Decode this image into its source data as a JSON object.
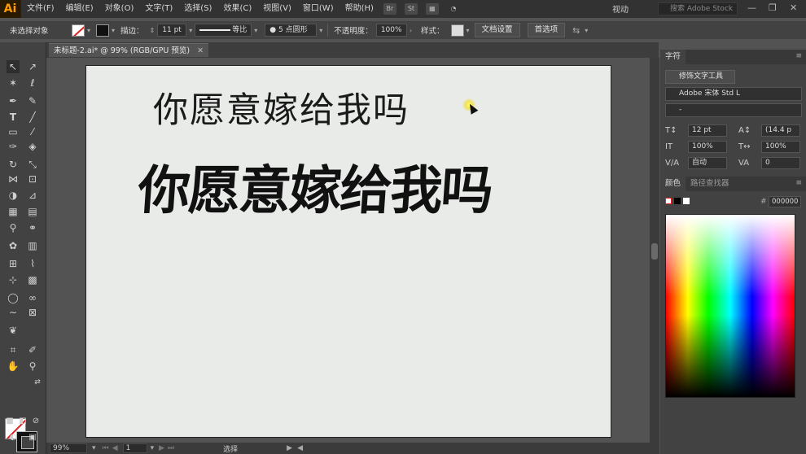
{
  "app": {
    "logo": "Ai"
  },
  "menu": {
    "items": [
      "文件(F)",
      "编辑(E)",
      "对象(O)",
      "文字(T)",
      "选择(S)",
      "效果(C)",
      "视图(V)",
      "窗口(W)",
      "帮助(H)"
    ],
    "bridge_label": "Br",
    "stock_label": "St",
    "workspace": "视动",
    "search_placeholder": "搜索 Adobe Stock"
  },
  "control_bar": {
    "selection_status": "未选择对象",
    "stroke_label": "描边：",
    "stroke_value": "11 pt",
    "stroke_profile": "等比",
    "brush_value": "5 点圆形",
    "opacity_label": "不透明度：",
    "opacity_value": "100%",
    "style_label": "样式：",
    "doc_setup_label": "文档设置",
    "preferences_label": "首选项"
  },
  "document": {
    "tab_title": "未标题-2.ai* @ 99% (RGB/GPU 预览)",
    "line1": "你愿意嫁给我吗",
    "line2": "你愿意嫁给我吗"
  },
  "status_bar": {
    "zoom": "99%",
    "page": "1",
    "tool": "选择"
  },
  "character_panel": {
    "tab": "字符",
    "touch_type_label": "修饰文字工具",
    "font_family": "Adobe 宋体 Std L",
    "font_style": "-",
    "font_size": "12 pt",
    "leading": "(14.4 p",
    "vertical_scale": "100%",
    "horizontal_scale": "100%",
    "kerning": "自动",
    "tracking": "0"
  },
  "color_panel": {
    "tab_color": "颜色",
    "tab_pathfinder": "路径查找器",
    "hex_label": "#",
    "hex_value": "000000"
  },
  "colors": {
    "accent": "#ff9a00",
    "artboard": "#e8ebe8",
    "text": "#111111"
  }
}
